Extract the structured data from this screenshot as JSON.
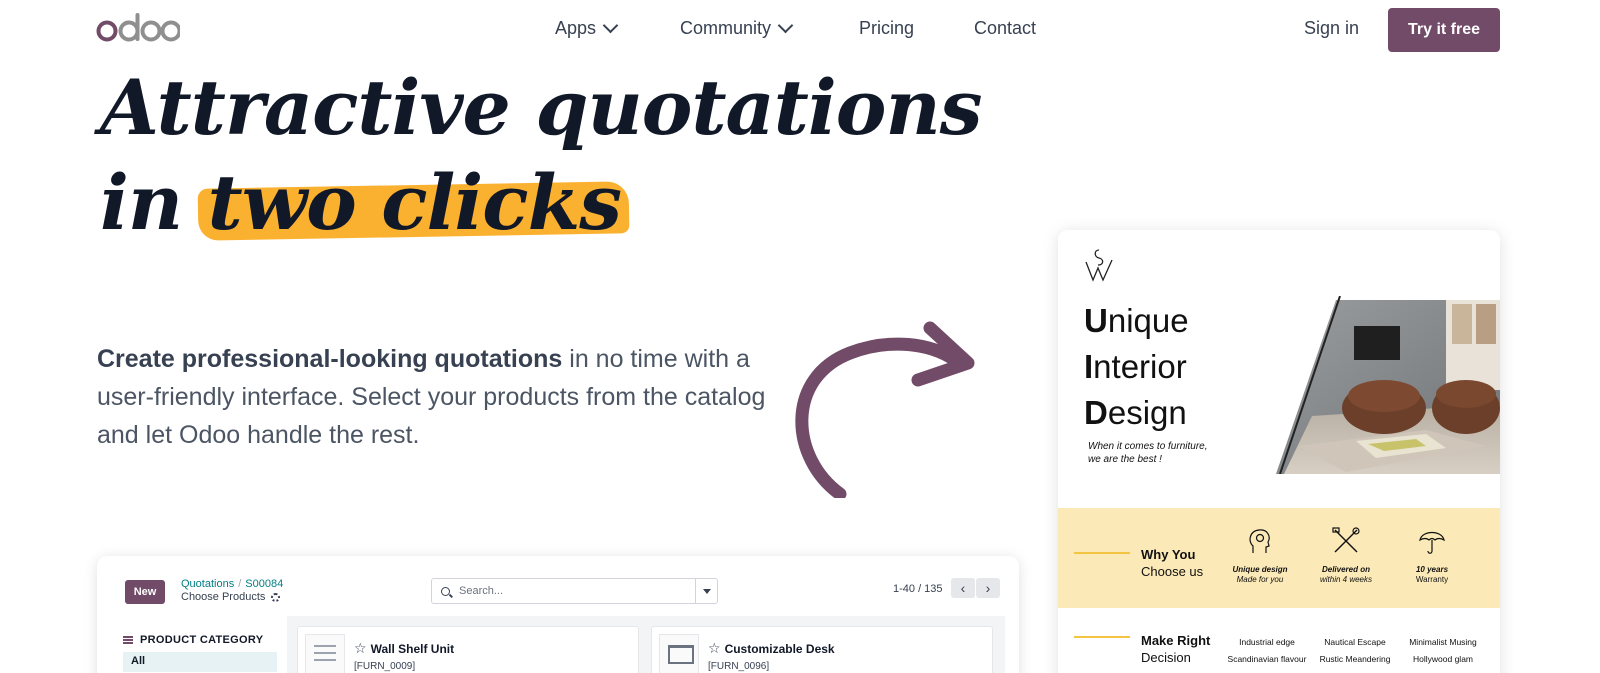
{
  "nav": {
    "logo": "odoo",
    "items": [
      {
        "label": "Apps",
        "has_dropdown": true
      },
      {
        "label": "Community",
        "has_dropdown": true
      },
      {
        "label": "Pricing",
        "has_dropdown": false
      },
      {
        "label": "Contact",
        "has_dropdown": false
      }
    ],
    "sign_in": "Sign in",
    "cta": "Try it free"
  },
  "hero": {
    "title_line1": "Attractive quotations",
    "title_line2_prefix": "in ",
    "title_highlight": "two clicks",
    "description_bold": "Create professional-looking quotations",
    "description_rest": " in no time with a user-friendly interface. Select your products from the catalog and let Odoo handle the rest."
  },
  "app_mockup": {
    "new_button": "New",
    "breadcrumb_root": "Quotations",
    "breadcrumb_separator": "/",
    "breadcrumb_record": "S00084",
    "subtitle": "Choose Products",
    "search_placeholder": "Search...",
    "pager": "1-40 / 135",
    "category_title": "PRODUCT CATEGORY",
    "category_selected": "All",
    "products": [
      {
        "name": "Wall Shelf Unit",
        "ref": "[FURN_0009]"
      },
      {
        "name": "Customizable Desk",
        "ref": "[FURN_0096]"
      }
    ]
  },
  "brochure": {
    "monogram": "SW",
    "heading_lines": [
      {
        "cap": "U",
        "rest": "nique"
      },
      {
        "cap": "I",
        "rest": "nterior"
      },
      {
        "cap": "D",
        "rest": "esign"
      }
    ],
    "tagline_line1": "When it comes to furniture,",
    "tagline_line2": "we are the best !",
    "why_line1": "Why You",
    "why_line2": "Choose us",
    "features": [
      {
        "title": "Unique design",
        "subtitle": "Made for you",
        "icon": "head-gear-icon"
      },
      {
        "title": "Delivered on",
        "subtitle": "within 4 weeks",
        "icon": "tools-icon"
      },
      {
        "title": "10 years",
        "subtitle": "Warranty",
        "icon": "umbrella-icon"
      }
    ],
    "decision_line1": "Make Right",
    "decision_line2": "Decision",
    "styles": [
      [
        "Industrial edge",
        "Scandinavian flavour"
      ],
      [
        "Nautical Escape",
        "Rustic Meandering"
      ],
      [
        "Minimalist Musing",
        "Hollywood glam"
      ]
    ]
  },
  "colors": {
    "brand": "#714b67",
    "highlight": "#fbb130",
    "band": "#fbe9b7"
  }
}
